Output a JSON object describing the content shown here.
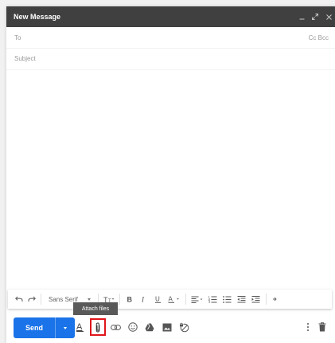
{
  "window": {
    "title": "New Message",
    "buttons": [
      "minimize-icon",
      "expand-icon",
      "close-icon"
    ]
  },
  "fields": {
    "to_label": "To",
    "cc_bcc": "Cc Bcc",
    "subject_placeholder": "Subject"
  },
  "format_toolbar": {
    "font_family": "Sans Serif",
    "icons": [
      "undo-icon",
      "redo-icon",
      "font-family-select",
      "text-size-icon",
      "bold-icon",
      "italic-icon",
      "underline-icon",
      "text-color-icon",
      "align-icon",
      "numbered-list-icon",
      "bulleted-list-icon",
      "indent-less-icon",
      "indent-more-icon",
      "more-formatting-icon"
    ]
  },
  "tooltip": {
    "text": "Attach files"
  },
  "bottom_toolbar": {
    "send_label": "Send",
    "icons": [
      "formatting-options-icon",
      "attach-files-icon",
      "insert-link-icon",
      "insert-emoji-icon",
      "google-drive-icon",
      "insert-photo-icon",
      "confidential-mode-icon",
      "more-options-icon",
      "discard-draft-icon"
    ]
  },
  "colors": {
    "titlebar": "#404040",
    "send_button": "#1a73e8",
    "highlight": "#e0151a"
  }
}
